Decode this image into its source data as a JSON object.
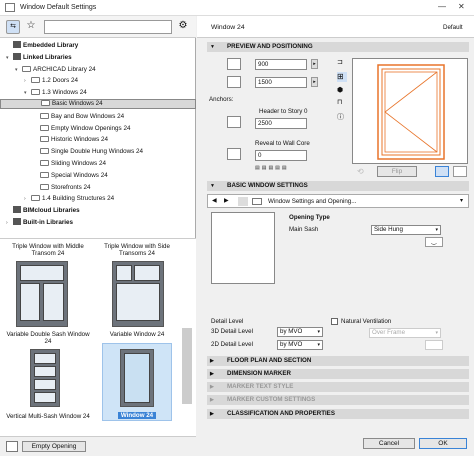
{
  "window": {
    "title": "Window Default Settings",
    "min": "—",
    "close": "✕"
  },
  "left": {
    "tree": [
      {
        "label": "Embedded Library",
        "indent": 0,
        "icon": "library-icon",
        "arrow": ""
      },
      {
        "label": "Linked Libraries",
        "indent": 0,
        "icon": "library-icon",
        "arrow": "▾"
      },
      {
        "label": "ARCHICAD Library 24",
        "indent": 1,
        "icon": "folder-icon",
        "arrow": "▾"
      },
      {
        "label": "1.2 Doors 24",
        "indent": 2,
        "icon": "folder-icon",
        "arrow": "›"
      },
      {
        "label": "1.3 Windows 24",
        "indent": 2,
        "icon": "folder-icon",
        "arrow": "▾"
      },
      {
        "label": "Basic Windows 24",
        "indent": 3,
        "icon": "folder-icon",
        "arrow": "",
        "selected": true
      },
      {
        "label": "Bay and Bow Windows 24",
        "indent": 3,
        "icon": "folder-icon",
        "arrow": ""
      },
      {
        "label": "Empty Window Openings 24",
        "indent": 3,
        "icon": "folder-icon",
        "arrow": ""
      },
      {
        "label": "Historic Windows 24",
        "indent": 3,
        "icon": "folder-icon",
        "arrow": ""
      },
      {
        "label": "Single Double Hung Windows 24",
        "indent": 3,
        "icon": "folder-icon",
        "arrow": ""
      },
      {
        "label": "Sliding Windows 24",
        "indent": 3,
        "icon": "folder-icon",
        "arrow": ""
      },
      {
        "label": "Special Windows 24",
        "indent": 3,
        "icon": "folder-icon",
        "arrow": ""
      },
      {
        "label": "Storefronts 24",
        "indent": 3,
        "icon": "folder-icon",
        "arrow": ""
      },
      {
        "label": "1.4 Building Structures 24",
        "indent": 2,
        "icon": "folder-icon",
        "arrow": "›"
      },
      {
        "label": "BIMcloud Libraries",
        "indent": 0,
        "icon": "library-icon",
        "arrow": ""
      },
      {
        "label": "Built-in Libraries",
        "indent": 0,
        "icon": "library-icon",
        "arrow": "›"
      }
    ],
    "thumbs": {
      "t1_top": "Triple Window with Middle Transom 24",
      "t2_top": "Triple Window with Side Transoms 24",
      "t3": "Variable Double Sash Window 24",
      "t4": "Variable Window 24",
      "t5": "Vertical Multi-Sash Window 24",
      "t6": "Window 24"
    },
    "empty_opening": "Empty Opening"
  },
  "right": {
    "name": "Window 24",
    "default_label": "Default",
    "sec_preview": "PREVIEW AND POSITIONING",
    "width": "900",
    "height": "1500",
    "anchors": "Anchors:",
    "header_to_story": "Header to Story 0",
    "header_value": "2500",
    "reveal": "Reveal to Wall Core",
    "reveal_value": "0",
    "flip": "Flip",
    "sec_basic": "BASIC WINDOW SETTINGS",
    "subtab": "Window Settings and Opening...",
    "opening_type": "Opening Type",
    "main_sash": "Main Sash",
    "main_sash_value": "Side Hung",
    "detail_level": "Detail Level",
    "detail_3d": "3D Detail Level",
    "detail_3d_value": "by MVO",
    "detail_2d": "2D Detail Level",
    "detail_2d_value": "by MVO",
    "natural_vent": "Natural Ventilation",
    "over_frame": "Over Frame",
    "sec_floor": "FLOOR PLAN AND SECTION",
    "sec_dim": "DIMENSION MARKER",
    "sec_marker_text": "MARKER TEXT STYLE",
    "sec_marker_custom": "MARKER CUSTOM SETTINGS",
    "sec_class": "CLASSIFICATION AND PROPERTIES",
    "cancel": "Cancel",
    "ok": "OK"
  },
  "colors": {
    "accent": "#e8742a",
    "selection": "#3a83d6"
  }
}
